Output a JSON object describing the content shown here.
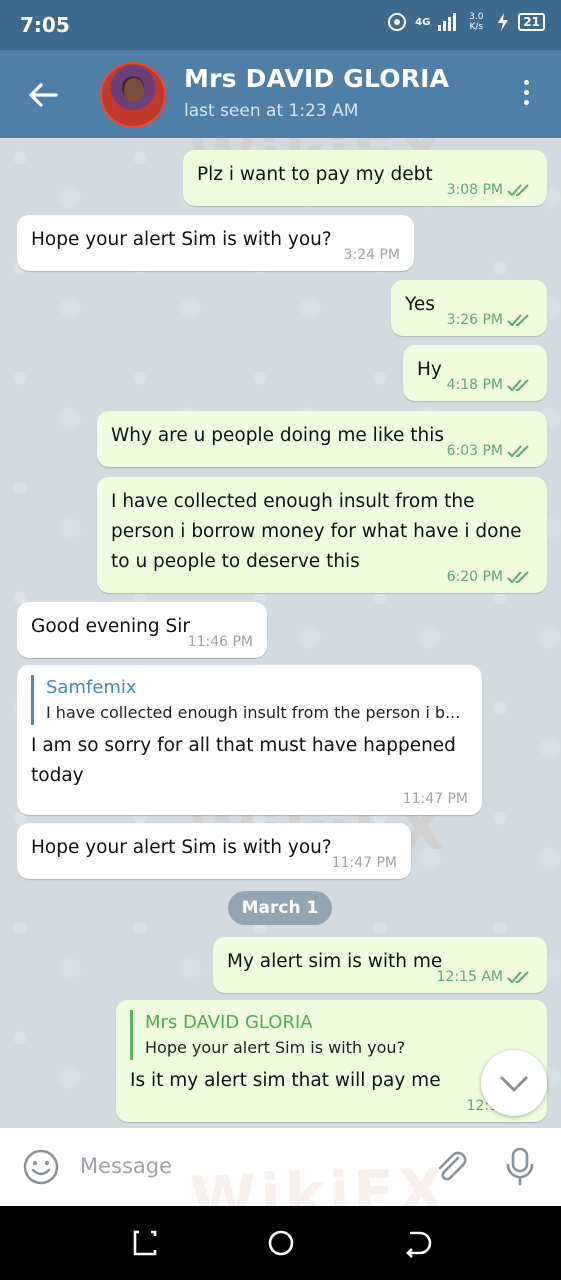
{
  "status_bar": {
    "time": "7:05",
    "network": "4G",
    "speed": "3.0 K/s",
    "battery": "21"
  },
  "header": {
    "title": "Mrs DAVID GLORIA",
    "subtitle": "last seen at 1:23 AM"
  },
  "messages": [
    {
      "dir": "out",
      "text": "Plz i want to pay my debt",
      "time": "3:08 PM",
      "read": true
    },
    {
      "dir": "in",
      "text": "Hope your alert Sim is with you?",
      "time": "3:24 PM"
    },
    {
      "dir": "out",
      "text": "Yes",
      "time": "3:26 PM",
      "read": true
    },
    {
      "dir": "out",
      "text": "Hy",
      "time": "4:18 PM",
      "read": true
    },
    {
      "dir": "out",
      "text": "Why are u people doing me like this",
      "time": "6:03 PM",
      "read": true
    },
    {
      "dir": "out",
      "text": "I have collected enough insult from the person i borrow money for what have i done to u people to deserve this",
      "time": "6:20 PM",
      "read": true
    },
    {
      "dir": "in",
      "text": "Good evening Sir",
      "time": "11:46 PM"
    },
    {
      "dir": "in",
      "reply_name": "Samfemix",
      "reply_text": "I have collected enough insult from the person i b...",
      "text": "I am so sorry for all that must have happened today",
      "time": "11:47 PM"
    },
    {
      "dir": "in",
      "text": "Hope your alert Sim is with you?",
      "time": "11:47 PM"
    },
    {
      "dir": "out",
      "text": "My alert sim is with me",
      "time": "12:15 AM",
      "read": true
    },
    {
      "dir": "out",
      "reply_name": "Mrs DAVID GLORIA",
      "reply_text": "Hope your alert Sim is with you?",
      "text": "Is it my alert sim that will pay me",
      "time": "12:16 AM",
      "read": true
    }
  ],
  "date_separator": "March 1",
  "watermark": "WikiFX",
  "input": {
    "placeholder": "Message"
  },
  "colors": {
    "header": "#4f7ea6",
    "outgoing_bubble": "#effdde",
    "incoming_bubble": "#ffffff",
    "check": "#5fa86a",
    "reply_in": "#3f89c6",
    "reply_out": "#4fae4e"
  }
}
